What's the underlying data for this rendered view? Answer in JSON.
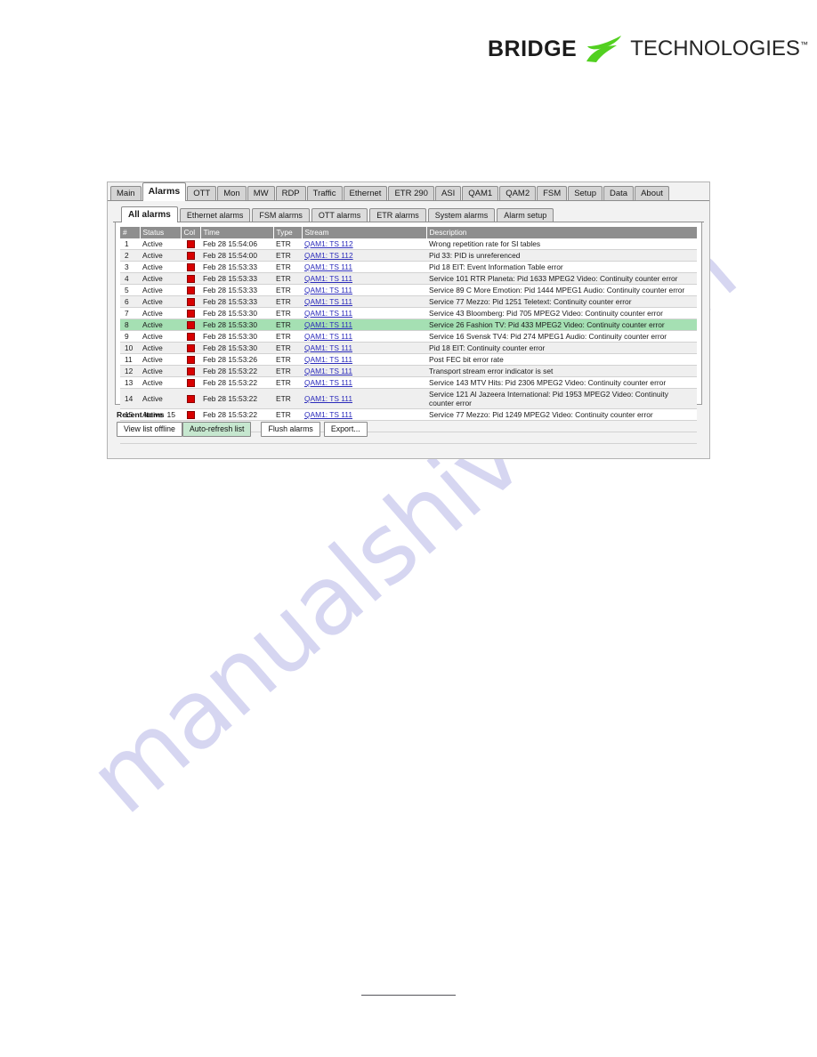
{
  "logo": {
    "word1": "BRIDGE",
    "word2": "TECHNOLOGIES",
    "trademark": "™",
    "swoosh_color": "#52d020",
    "text_color": "#1b1b1b"
  },
  "watermark": {
    "text": "manualshive.com",
    "color": "#d3d3f0"
  },
  "primary_tabs": [
    {
      "label": "Main",
      "active": false
    },
    {
      "label": "Alarms",
      "active": true
    },
    {
      "label": "OTT",
      "active": false
    },
    {
      "label": "Mon",
      "active": false
    },
    {
      "label": "MW",
      "active": false
    },
    {
      "label": "RDP",
      "active": false
    },
    {
      "label": "Traffic",
      "active": false
    },
    {
      "label": "Ethernet",
      "active": false
    },
    {
      "label": "ETR 290",
      "active": false
    },
    {
      "label": "ASI",
      "active": false
    },
    {
      "label": "QAM1",
      "active": false
    },
    {
      "label": "QAM2",
      "active": false
    },
    {
      "label": "FSM",
      "active": false
    },
    {
      "label": "Setup",
      "active": false
    },
    {
      "label": "Data",
      "active": false
    },
    {
      "label": "About",
      "active": false
    }
  ],
  "secondary_tabs": [
    {
      "label": "All alarms",
      "active": true
    },
    {
      "label": "Ethernet alarms",
      "active": false
    },
    {
      "label": "FSM alarms",
      "active": false
    },
    {
      "label": "OTT alarms",
      "active": false
    },
    {
      "label": "ETR alarms",
      "active": false
    },
    {
      "label": "System alarms",
      "active": false
    },
    {
      "label": "Alarm setup",
      "active": false
    }
  ],
  "table": {
    "headers": [
      "#",
      "Status",
      "Col",
      "Time",
      "Type",
      "Stream",
      "Description"
    ],
    "severity_color": "#d80000",
    "highlight_color": "#a5e0b3",
    "rows": [
      {
        "num": "1",
        "status": "Active",
        "time": "Feb 28 15:54:06",
        "type": "ETR",
        "stream": "QAM1: TS 112",
        "description": "Wrong repetition rate for SI tables",
        "highlight": false
      },
      {
        "num": "2",
        "status": "Active",
        "time": "Feb 28 15:54:00",
        "type": "ETR",
        "stream": "QAM1: TS 112",
        "description": "Pid 33: PID is unreferenced",
        "highlight": false
      },
      {
        "num": "3",
        "status": "Active",
        "time": "Feb 28 15:53:33",
        "type": "ETR",
        "stream": "QAM1: TS 111",
        "description": "Pid 18 EIT: Event Information Table error",
        "highlight": false
      },
      {
        "num": "4",
        "status": "Active",
        "time": "Feb 28 15:53:33",
        "type": "ETR",
        "stream": "QAM1: TS 111",
        "description": "Service 101 RTR Planeta: Pid 1633 MPEG2 Video: Continuity counter error",
        "highlight": false
      },
      {
        "num": "5",
        "status": "Active",
        "time": "Feb 28 15:53:33",
        "type": "ETR",
        "stream": "QAM1: TS 111",
        "description": "Service 89 C More Emotion: Pid 1444 MPEG1 Audio: Continuity counter error",
        "highlight": false
      },
      {
        "num": "6",
        "status": "Active",
        "time": "Feb 28 15:53:33",
        "type": "ETR",
        "stream": "QAM1: TS 111",
        "description": "Service 77 Mezzo: Pid 1251 Teletext: Continuity counter error",
        "highlight": false
      },
      {
        "num": "7",
        "status": "Active",
        "time": "Feb 28 15:53:30",
        "type": "ETR",
        "stream": "QAM1: TS 111",
        "description": "Service 43 Bloomberg: Pid 705 MPEG2 Video: Continuity counter error",
        "highlight": false
      },
      {
        "num": "8",
        "status": "Active",
        "time": "Feb 28 15:53:30",
        "type": "ETR",
        "stream": "QAM1: TS 111",
        "description": "Service 26 Fashion TV: Pid 433 MPEG2 Video: Continuity counter error",
        "highlight": true
      },
      {
        "num": "9",
        "status": "Active",
        "time": "Feb 28 15:53:30",
        "type": "ETR",
        "stream": "QAM1: TS 111",
        "description": "Service 16 Svensk TV4: Pid 274 MPEG1 Audio: Continuity counter error",
        "highlight": false
      },
      {
        "num": "10",
        "status": "Active",
        "time": "Feb 28 15:53:30",
        "type": "ETR",
        "stream": "QAM1: TS 111",
        "description": "Pid 18 EIT: Continuity counter error",
        "highlight": false
      },
      {
        "num": "11",
        "status": "Active",
        "time": "Feb 28 15:53:26",
        "type": "ETR",
        "stream": "QAM1: TS 111",
        "description": "Post FEC bit error rate",
        "highlight": false
      },
      {
        "num": "12",
        "status": "Active",
        "time": "Feb 28 15:53:22",
        "type": "ETR",
        "stream": "QAM1: TS 111",
        "description": "Transport stream error indicator is set",
        "highlight": false
      },
      {
        "num": "13",
        "status": "Active",
        "time": "Feb 28 15:53:22",
        "type": "ETR",
        "stream": "QAM1: TS 111",
        "description": "Service 143 MTV Hits: Pid 2306 MPEG2 Video: Continuity counter error",
        "highlight": false
      },
      {
        "num": "14",
        "status": "Active",
        "time": "Feb 28 15:53:22",
        "type": "ETR",
        "stream": "QAM1: TS 111",
        "description": "Service 121 Al Jazeera International: Pid 1953 MPEG2 Video: Continuity counter error",
        "highlight": false
      },
      {
        "num": "15",
        "status": "Active",
        "time": "Feb 28 15:53:22",
        "type": "ETR",
        "stream": "QAM1: TS 111",
        "description": "Service 77 Mezzo: Pid 1249 MPEG2 Video: Continuity counter error",
        "highlight": false
      }
    ]
  },
  "footer": {
    "recent_items_label": "Recent items",
    "recent_items_count": "15",
    "buttons": [
      {
        "label": "View list offline",
        "style": "plain"
      },
      {
        "label": "Auto-refresh list",
        "style": "green"
      },
      {
        "label": "Flush alarms",
        "style": "plain"
      },
      {
        "label": "Export...",
        "style": "plain"
      }
    ]
  }
}
